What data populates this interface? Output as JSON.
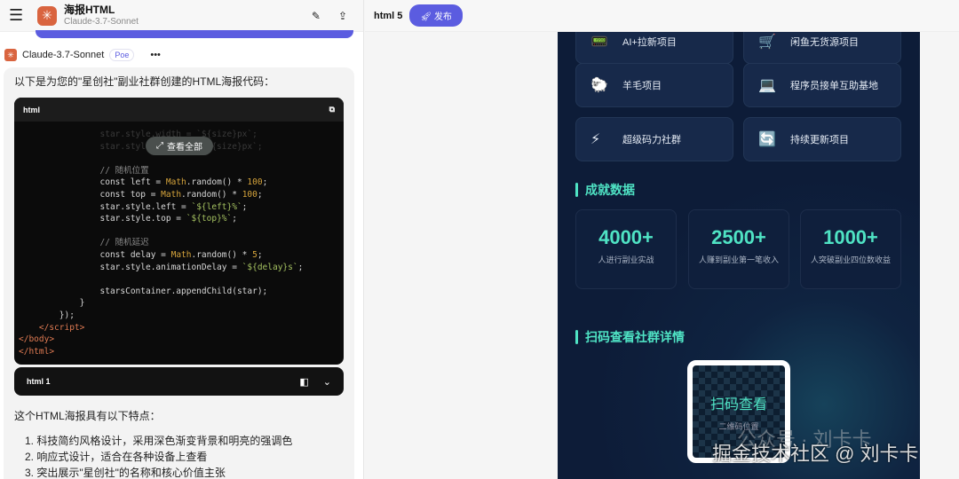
{
  "app": {
    "title": "海报HTML",
    "model": "Claude-3.7-Sonnet"
  },
  "message": {
    "bot": "Claude-3.7-Sonnet",
    "badge": "Poe",
    "more": "•••",
    "intro": "以下是为您的\"星创社\"副业社群创建的HTML海报代码：",
    "code_lang": "html",
    "view_all": "查看全部",
    "artifact": "html 1",
    "features_title": "这个HTML海报具有以下特点：",
    "features": [
      "1. 科技简约风格设计，采用深色渐变背景和明亮的强调色",
      "2. 响应式设计，适合在各种设备上查看",
      "3. 突出展示\"星创社\"的名称和核心价值主张"
    ]
  },
  "preview": {
    "title": "html 5",
    "publish": "发布",
    "projects": [
      {
        "icon": "📟",
        "label": "AI+拉新项目"
      },
      {
        "icon": "🛒",
        "label": "闲鱼无货源项目"
      },
      {
        "icon": "🐑",
        "label": "羊毛项目"
      },
      {
        "icon": "💻",
        "label": "程序员接单互助基地"
      },
      {
        "icon": "⚡",
        "label": "超级码力社群"
      },
      {
        "icon": "🔄",
        "label": "持续更新项目"
      }
    ],
    "stats_title": "成就数据",
    "stats": [
      {
        "num": "4000+",
        "label": "人进行副业实战"
      },
      {
        "num": "2500+",
        "label": "人赚到副业第一笔收入"
      },
      {
        "num": "1000+",
        "label": "人突破副业四位数收益"
      }
    ],
    "qr_title": "扫码查看社群详情",
    "qr_main": "扫码查看",
    "qr_sub": "二维码位置"
  },
  "watermark": {
    "a": "公众号 · 刘卡卡",
    "b": "掘金技术社区 @ 刘卡卡"
  },
  "colors": {
    "accent": "#5b5ce0",
    "teal": "#4fe3c4",
    "poster_bg": "#0d1c38"
  }
}
